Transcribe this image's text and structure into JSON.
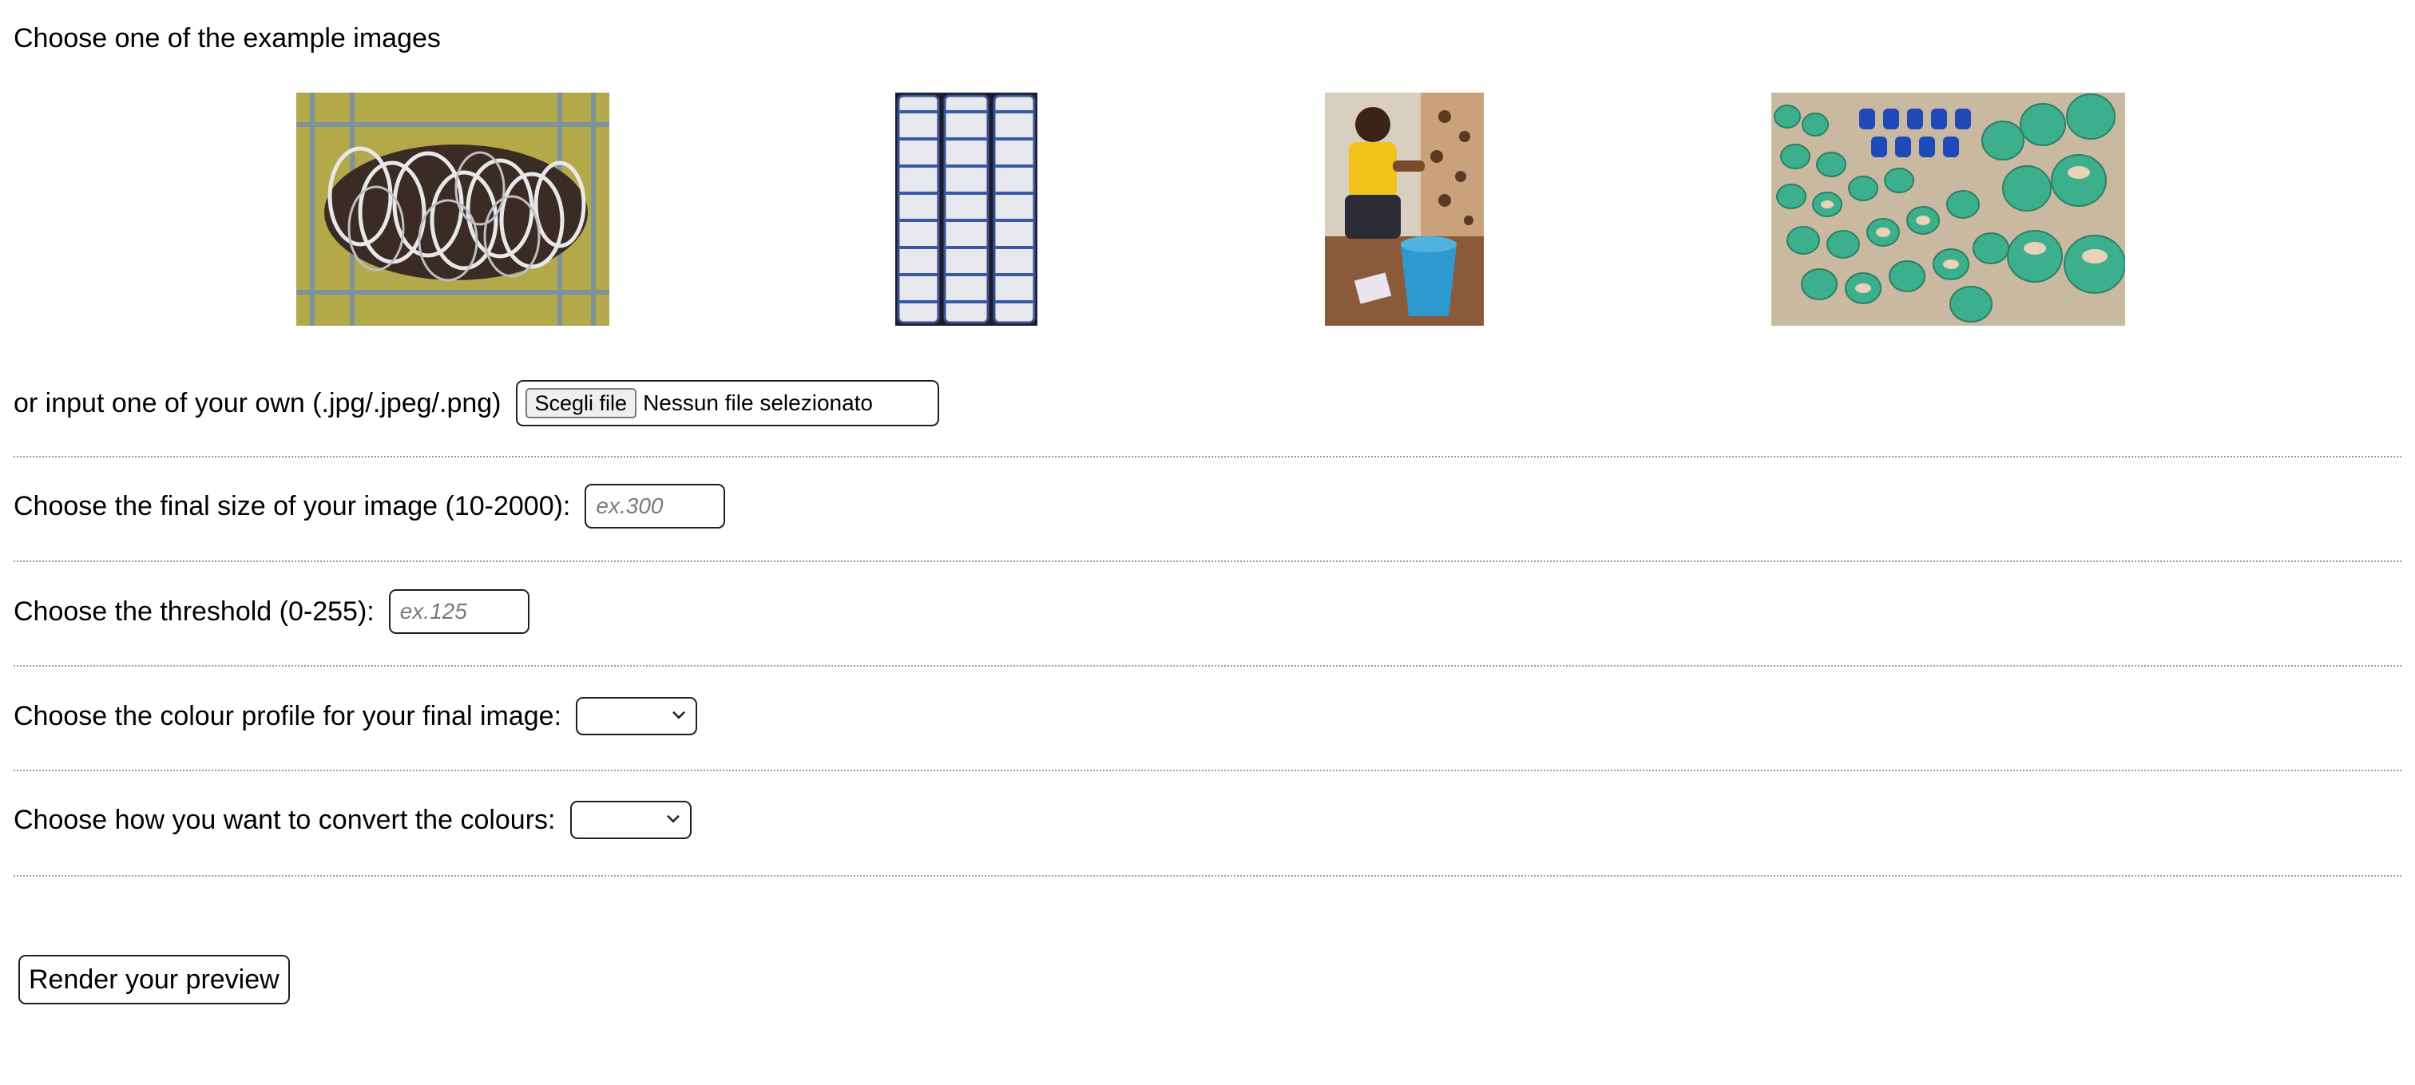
{
  "heading": "Choose one of the example images",
  "examples": [
    {
      "icon": "bracelets-photo"
    },
    {
      "icon": "stacked-bowls-photo"
    },
    {
      "icon": "potter-woman-photo"
    },
    {
      "icon": "green-pottery-photo"
    }
  ],
  "upload": {
    "label": "or input one of your own (.jpg/.jpeg/.png)",
    "button_label": "Scegli file",
    "status": "Nessun file selezionato"
  },
  "size": {
    "label": "Choose the final size of your image (10-2000):",
    "placeholder": "ex.300",
    "value": ""
  },
  "threshold": {
    "label": "Choose the threshold (0-255):",
    "placeholder": "ex.125",
    "value": ""
  },
  "colour_profile": {
    "label": "Choose the colour profile for your final image:",
    "selected": ""
  },
  "conversion": {
    "label": "Choose how you want to convert the colours:",
    "selected": ""
  },
  "render_button": "Render your preview",
  "colors": {
    "border": "#1f1f1f",
    "divider": "#9a9a9a",
    "placeholder": "#7a7a7a"
  }
}
